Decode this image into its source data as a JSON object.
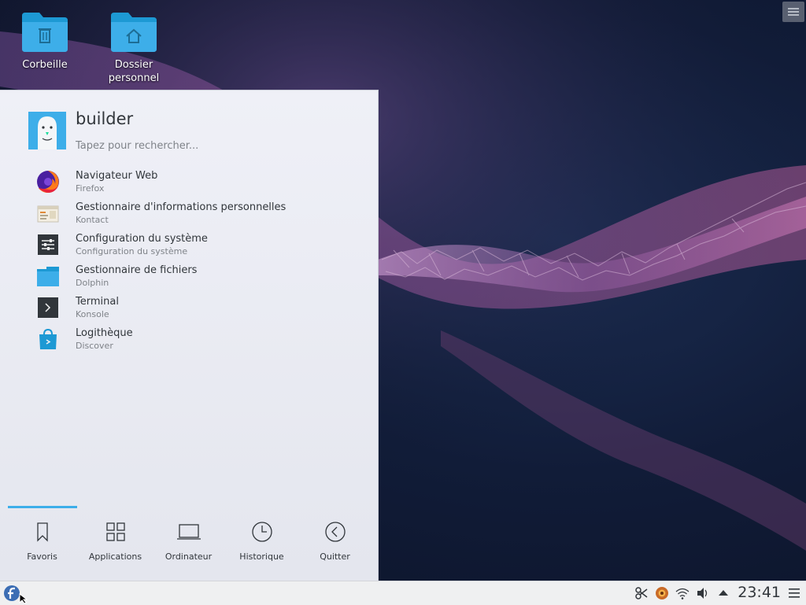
{
  "desktop": {
    "icons": [
      {
        "label": "Corbeille"
      },
      {
        "label": "Dossier\npersonnel"
      }
    ]
  },
  "launcher": {
    "user_name": "builder",
    "search_placeholder": "Tapez pour rechercher...",
    "favorites": [
      {
        "name": "Navigateur Web",
        "sub": "Firefox",
        "icon": "firefox-icon"
      },
      {
        "name": "Gestionnaire d'informations personnelles",
        "sub": "Kontact",
        "icon": "kontact-icon"
      },
      {
        "name": "Configuration du système",
        "sub": "Configuration du système",
        "icon": "system-settings-icon"
      },
      {
        "name": "Gestionnaire de fichiers",
        "sub": "Dolphin",
        "icon": "dolphin-icon"
      },
      {
        "name": "Terminal",
        "sub": "Konsole",
        "icon": "konsole-icon"
      },
      {
        "name": "Logithèque",
        "sub": "Discover",
        "icon": "discover-icon"
      }
    ],
    "tabs": [
      {
        "label": "Favoris",
        "icon": "bookmark-icon",
        "active": true
      },
      {
        "label": "Applications",
        "icon": "grid-icon"
      },
      {
        "label": "Ordinateur",
        "icon": "laptop-icon"
      },
      {
        "label": "Historique",
        "icon": "clock-icon"
      },
      {
        "label": "Quitter",
        "icon": "back-arrow-icon"
      }
    ]
  },
  "panel": {
    "clock": "23:41"
  },
  "colors": {
    "accent": "#3daee9",
    "text": "#31363b",
    "subtext": "#7f8389"
  }
}
